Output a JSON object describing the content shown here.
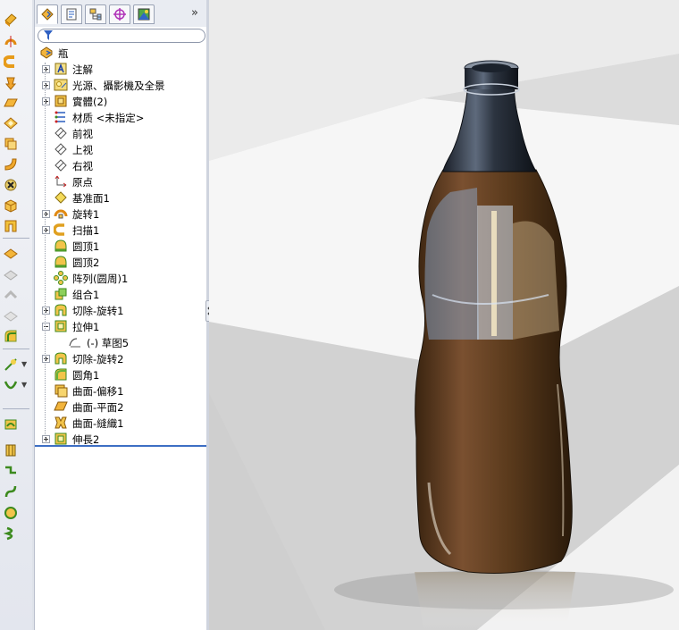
{
  "panel": {
    "more_label": "»",
    "tree": [
      {
        "label": "瓶",
        "icon": "part-icon",
        "expander": "none"
      },
      {
        "label": "注解",
        "icon": "annotations-icon",
        "expander": "plus"
      },
      {
        "label": "光源、攝影機及全景",
        "icon": "lights-camera-icon",
        "expander": "plus"
      },
      {
        "label": "實體(2)",
        "icon": "solid-bodies-icon",
        "expander": "plus"
      },
      {
        "label": "材质 <未指定>",
        "icon": "material-icon",
        "expander": "none"
      },
      {
        "label": "前视",
        "icon": "plane-icon",
        "expander": "none"
      },
      {
        "label": "上视",
        "icon": "plane-icon",
        "expander": "none"
      },
      {
        "label": "右视",
        "icon": "plane-icon",
        "expander": "none"
      },
      {
        "label": "原点",
        "icon": "origin-icon",
        "expander": "none"
      },
      {
        "label": "基准面1",
        "icon": "ref-plane-icon",
        "expander": "none"
      },
      {
        "label": "旋转1",
        "icon": "revolve-icon",
        "expander": "plus"
      },
      {
        "label": "扫描1",
        "icon": "sweep-icon",
        "expander": "plus"
      },
      {
        "label": "圆顶1",
        "icon": "dome-icon",
        "expander": "none"
      },
      {
        "label": "圆顶2",
        "icon": "dome-icon",
        "expander": "none"
      },
      {
        "label": "阵列(圆周)1",
        "icon": "circular-pattern-icon",
        "expander": "none"
      },
      {
        "label": "组合1",
        "icon": "combine-icon",
        "expander": "none"
      },
      {
        "label": "切除-旋转1",
        "icon": "cut-revolve-icon",
        "expander": "plus"
      },
      {
        "label": "拉伸1",
        "icon": "extrude-icon",
        "expander": "minus"
      },
      {
        "label": "(-) 草图5",
        "icon": "sketch-icon",
        "expander": "none",
        "indent": true
      },
      {
        "label": "切除-旋转2",
        "icon": "cut-revolve-icon",
        "expander": "plus"
      },
      {
        "label": "圆角1",
        "icon": "fillet-icon",
        "expander": "none"
      },
      {
        "label": "曲面-偏移1",
        "icon": "offset-surface-icon",
        "expander": "none"
      },
      {
        "label": "曲面-平面2",
        "icon": "planar-surface-icon",
        "expander": "none"
      },
      {
        "label": "曲面-縫織1",
        "icon": "knit-surface-icon",
        "expander": "none"
      },
      {
        "label": "伸長2",
        "icon": "extrude-icon",
        "expander": "plus"
      }
    ]
  },
  "colors": {
    "selection_line": "#3d6ec4",
    "liquid": "#5a3a1c",
    "glass": "#2c3440"
  }
}
